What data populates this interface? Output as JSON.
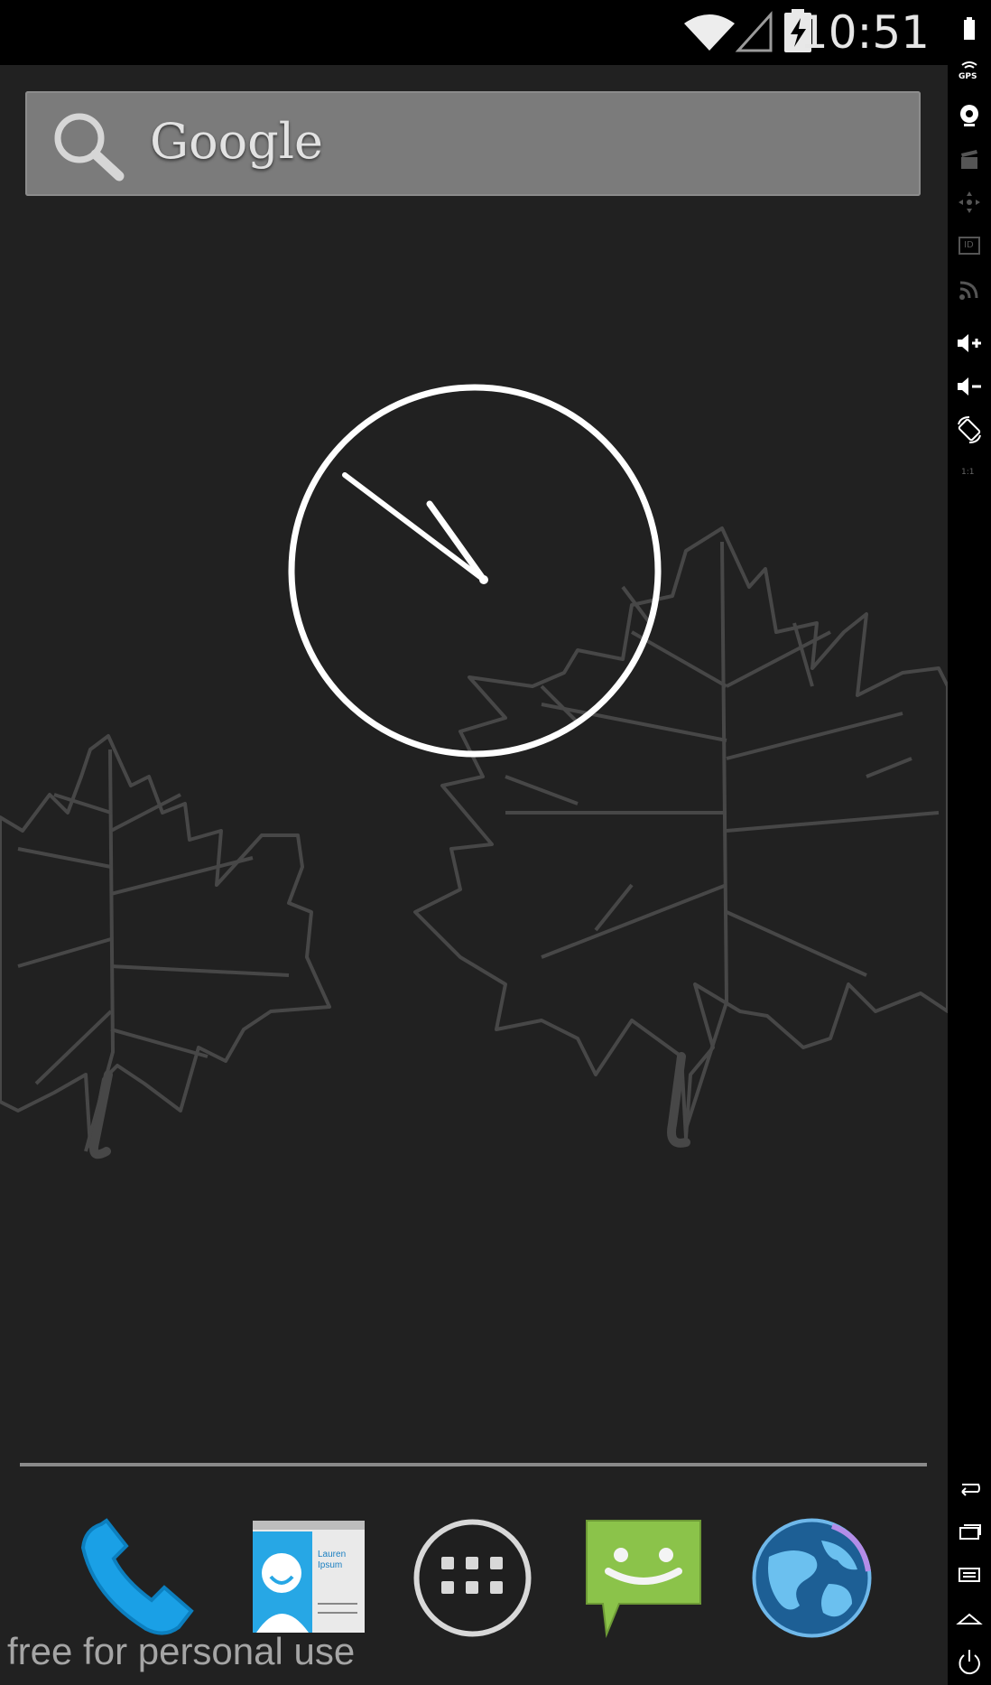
{
  "status_bar": {
    "time": "10:51",
    "icons": [
      "wifi-icon",
      "cell-signal-icon",
      "battery-charging-icon"
    ]
  },
  "search_widget": {
    "label": "Google",
    "icon": "search-icon"
  },
  "clock_widget": {
    "type": "analog",
    "hour": 10,
    "minute": 51
  },
  "dock": {
    "items": [
      {
        "name": "Phone",
        "icon": "phone-icon"
      },
      {
        "name": "Contacts",
        "icon": "contacts-icon",
        "card_text": "Lauren Ipsum"
      },
      {
        "name": "Apps",
        "icon": "app-drawer-icon"
      },
      {
        "name": "Messaging",
        "icon": "messaging-icon"
      },
      {
        "name": "Browser",
        "icon": "globe-icon"
      }
    ]
  },
  "watermark": "free for personal use",
  "emulator_sidebar": {
    "buttons": [
      {
        "name": "battery",
        "icon": "battery-icon"
      },
      {
        "name": "gps",
        "icon": "gps-icon",
        "label": "GPS"
      },
      {
        "name": "camera",
        "icon": "camera-icon"
      },
      {
        "name": "screencast",
        "icon": "clapperboard-icon"
      },
      {
        "name": "dpad",
        "icon": "dpad-icon"
      },
      {
        "name": "device-id",
        "icon": "id-icon",
        "label": "ID"
      },
      {
        "name": "network",
        "icon": "rss-icon"
      },
      {
        "name": "volume-up",
        "icon": "volume-up-icon"
      },
      {
        "name": "volume-down",
        "icon": "volume-down-icon"
      },
      {
        "name": "rotate",
        "icon": "rotate-icon"
      },
      {
        "name": "scale",
        "icon": "scale-icon",
        "label": "1:1"
      },
      {
        "name": "back",
        "icon": "back-icon"
      },
      {
        "name": "recent-apps",
        "icon": "recent-apps-icon"
      },
      {
        "name": "menu",
        "icon": "menu-icon"
      },
      {
        "name": "home",
        "icon": "home-icon"
      },
      {
        "name": "power",
        "icon": "power-icon"
      }
    ]
  },
  "colors": {
    "wallpaper": "#212121",
    "leaf_outline": "#4a4a4a",
    "search_bar": "#7b7b7b",
    "phone_blue": "#1aa0e6",
    "messaging_green": "#8bc34a"
  }
}
